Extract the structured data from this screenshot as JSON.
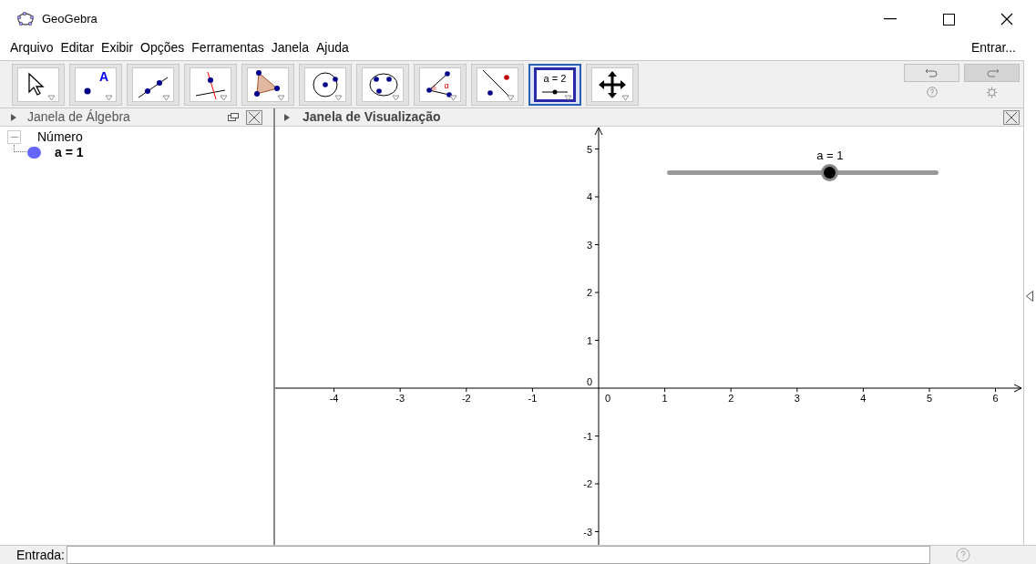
{
  "window": {
    "title": "GeoGebra"
  },
  "menu": [
    "Arquivo",
    "Editar",
    "Exibir",
    "Opções",
    "Ferramentas",
    "Janela",
    "Ajuda"
  ],
  "sign_in": "Entrar...",
  "tools": [
    {
      "kind": "move",
      "selected": false
    },
    {
      "kind": "point",
      "label": "A",
      "selected": false
    },
    {
      "kind": "line",
      "selected": false
    },
    {
      "kind": "perpendicular",
      "selected": false
    },
    {
      "kind": "polygon",
      "selected": false
    },
    {
      "kind": "circle",
      "selected": false
    },
    {
      "kind": "conic",
      "selected": false
    },
    {
      "kind": "angle",
      "label": "α",
      "selected": false
    },
    {
      "kind": "reflect",
      "selected": false
    },
    {
      "kind": "slider",
      "label": "a = 2",
      "selected": true
    },
    {
      "kind": "pan",
      "selected": false
    }
  ],
  "redo_disabled": true,
  "algebra": {
    "title": "Janela de Álgebra",
    "items": [
      {
        "label": "Número",
        "expanded": true,
        "children": [
          {
            "label": "a = 1",
            "color": "#6666ff"
          }
        ]
      }
    ]
  },
  "graphics": {
    "title": "Janela de Visualização",
    "x_labels": [
      "-4",
      "-3",
      "-2",
      "-1",
      "0",
      "1",
      "2",
      "3",
      "4",
      "5",
      "6"
    ],
    "y_labels": [
      "5",
      "4",
      "3",
      "2",
      "1",
      "0",
      "-1",
      "-2",
      "-3"
    ],
    "slider": {
      "label": "a = 1",
      "level": 0.6
    }
  },
  "input": {
    "label": "Entrada:"
  }
}
